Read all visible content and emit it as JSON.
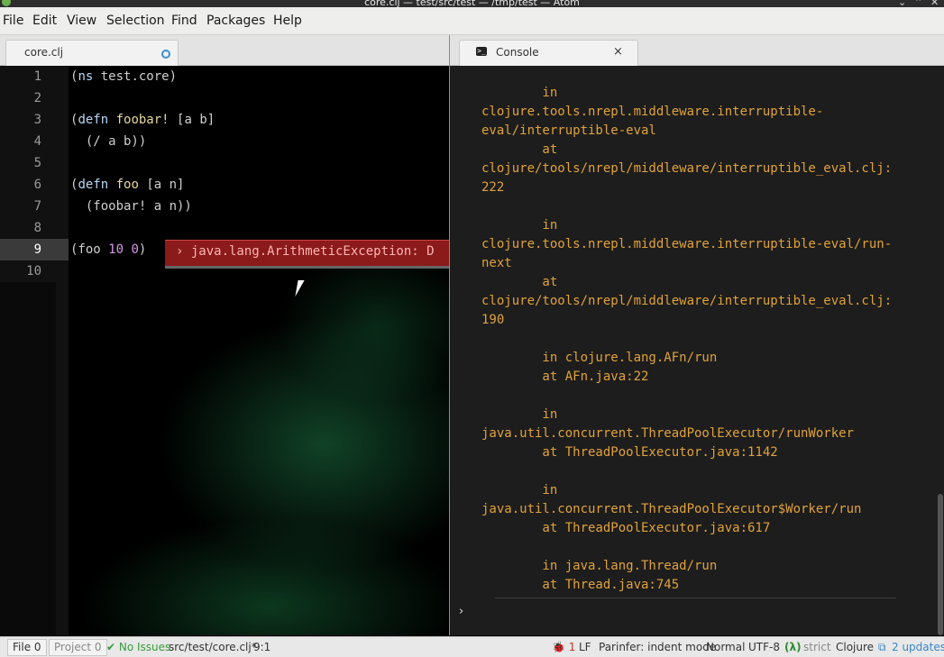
{
  "window": {
    "title": "core.clj — test/src/test — /tmp/test — Atom",
    "controls": [
      "⌄",
      "⌃",
      "✕"
    ]
  },
  "menu": [
    "File",
    "Edit",
    "View",
    "Selection",
    "Find",
    "Packages",
    "Help"
  ],
  "editor_tab": {
    "label": "core.clj",
    "modified": true
  },
  "console_tab": {
    "label": "Console",
    "close": "×"
  },
  "gutter": {
    "line_numbers": [
      "1",
      "2",
      "3",
      "4",
      "5",
      "6",
      "7",
      "8",
      "9",
      "10"
    ],
    "active_line": "9"
  },
  "code": {
    "l1": {
      "p1": "(",
      "kw": "ns",
      "p2": " test.core)"
    },
    "l3": {
      "p1": "(",
      "kw": "defn",
      "sp": " ",
      "fn": "foobar!",
      "p2": " [a b]"
    },
    "l4": {
      "text": "  (/ a b))"
    },
    "l6": {
      "p1": "(",
      "kw": "defn",
      "sp": " ",
      "fn": "foo",
      "p2": " [a n]"
    },
    "l7": {
      "text": "  (foobar! a n))"
    },
    "l9": {
      "p1": "(foo ",
      "n1": "10",
      "sp": " ",
      "n2": "0",
      "p2": ")"
    }
  },
  "inline_error": {
    "text": "› java.lang.ArithmeticException: D"
  },
  "console": {
    "lines": [
      "        in",
      "clojure.tools.nrepl.middleware.interruptible-",
      "eval/interruptible-eval",
      "        at",
      "clojure/tools/nrepl/middleware/interruptible_eval.clj:",
      "222",
      "",
      "        in",
      "clojure.tools.nrepl.middleware.interruptible-eval/run-",
      "next",
      "        at",
      "clojure/tools/nrepl/middleware/interruptible_eval.clj:",
      "190",
      "",
      "        in clojure.lang.AFn/run",
      "        at AFn.java:22",
      "",
      "        in",
      "java.util.concurrent.ThreadPoolExecutor/runWorker",
      "        at ThreadPoolExecutor.java:1142",
      "",
      "        in",
      "java.util.concurrent.ThreadPoolExecutor$Worker/run",
      "        at ThreadPoolExecutor.java:617",
      "",
      "        in java.lang.Thread/run",
      "        at Thread.java:745"
    ],
    "prompt": "›"
  },
  "status": {
    "file": "File 0",
    "project": "Project 0",
    "no_issues": "✔ No Issues",
    "path": "src/test/core.clj*",
    "cursor": "9:1",
    "bug_count": "🐞 1",
    "line_ending": "LF",
    "parinfer": "Parinfer: indent mode",
    "mode": "Normal",
    "encoding": "UTF-8",
    "lambda": "(λ)",
    "strict": "strict",
    "grammar": "Clojure",
    "updates": "2 updates"
  },
  "colors": {
    "console_text": "#e0a23a",
    "error_bg": "#8b1a1a",
    "updates_link": "#3a86c8",
    "ok_green": "#3a9a3a"
  }
}
